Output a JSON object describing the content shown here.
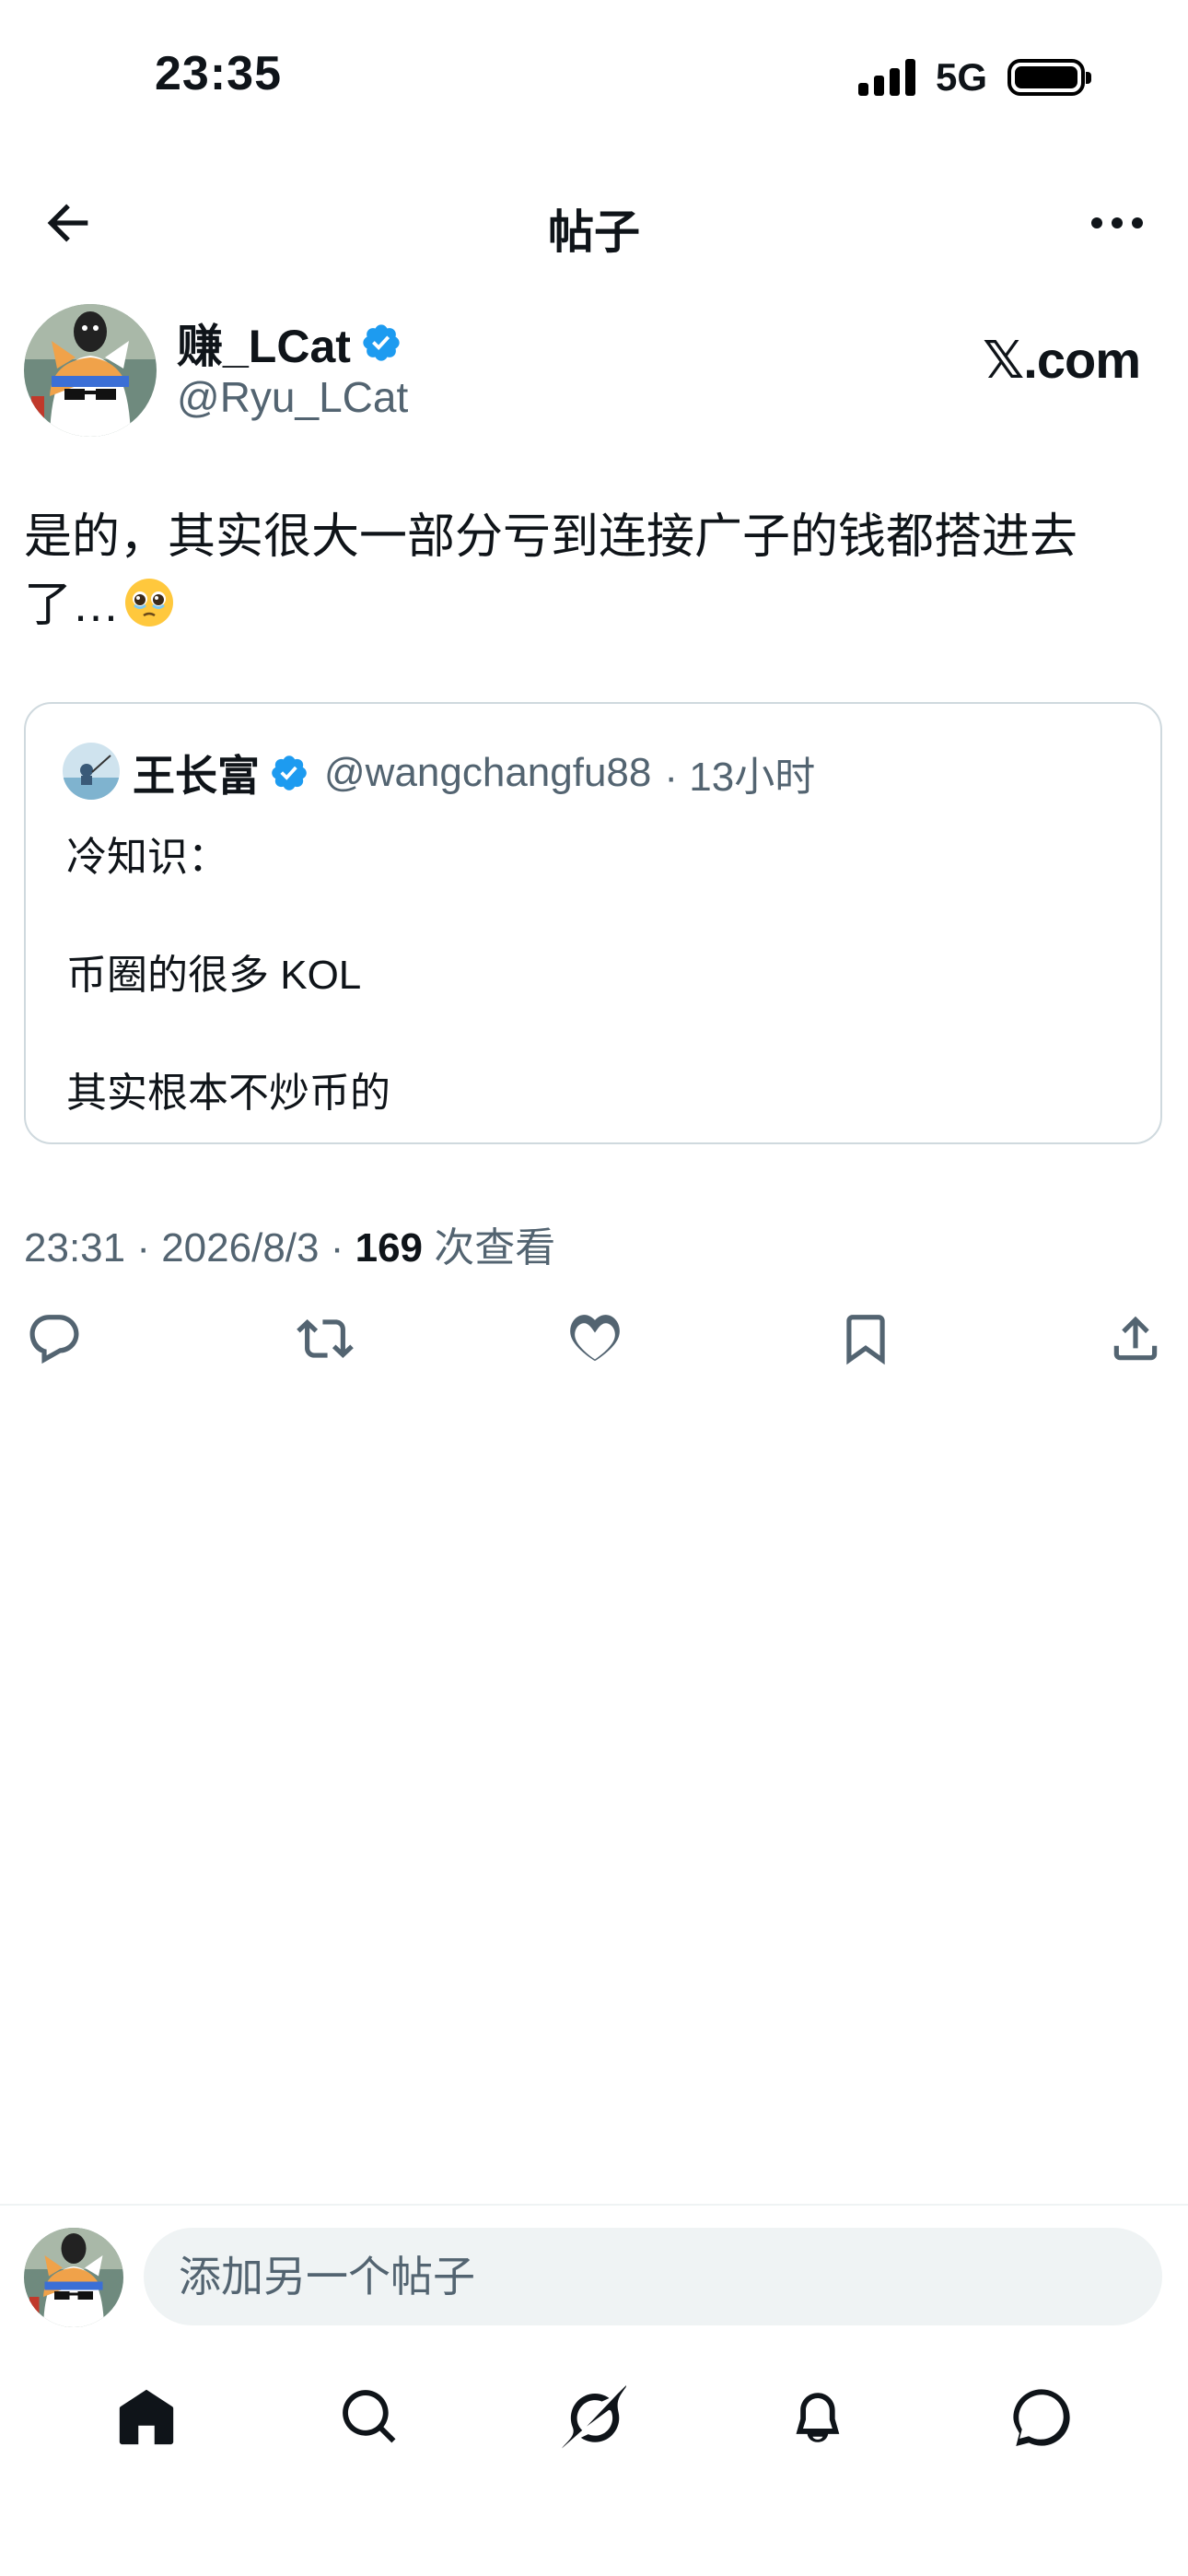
{
  "status_bar": {
    "time": "23:35",
    "network": "5G"
  },
  "header": {
    "title": "帖子"
  },
  "author": {
    "name": "赚_LCat",
    "handle": "@Ryu_LCat"
  },
  "brand": "𝕏.com",
  "post": {
    "text": "是的，其实很大一部分亏到连接广子的钱都搭进去了…",
    "emoji": "🥹"
  },
  "quoted": {
    "name": "王长富",
    "handle": "@wangchangfu88",
    "time": "· 13小时",
    "lines": [
      "冷知识：",
      "币圈的很多 KOL",
      "其实根本不炒币的"
    ]
  },
  "meta": {
    "time_date": "23:31 · 2026/8/3 · ",
    "views_count": "169",
    "views_label": " 次查看"
  },
  "actions": [
    "reply-icon",
    "retweet-icon",
    "like-icon",
    "bookmark-icon",
    "share-icon"
  ],
  "composer": {
    "placeholder": "添加另一个帖子"
  },
  "tabbar": [
    "home-icon",
    "search-icon",
    "grok-icon",
    "notifications-icon",
    "messages-icon"
  ],
  "colors": {
    "text": "#0f1419",
    "secondary": "#536471",
    "verified": "#1d9bf0",
    "border": "#cfd9de"
  }
}
